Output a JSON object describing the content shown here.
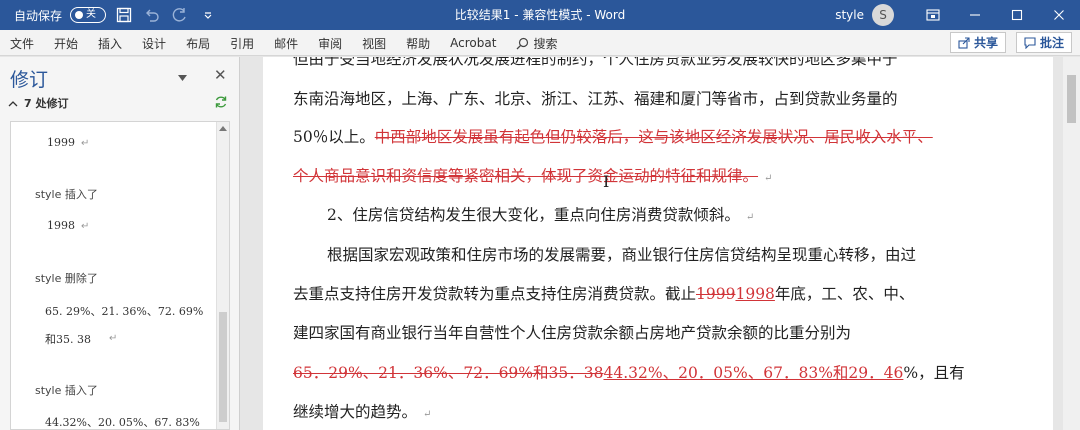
{
  "titlebar": {
    "autosave_label": "自动保存",
    "autosave_state": "关",
    "title": "比较结果1 - 兼容性模式 - Word",
    "user": "style",
    "avatar_letter": "S"
  },
  "menu": {
    "items": [
      "文件",
      "开始",
      "插入",
      "设计",
      "布局",
      "引用",
      "邮件",
      "审阅",
      "视图",
      "帮助",
      "Acrobat"
    ],
    "search": "搜索",
    "share": "共享",
    "comment": "批注"
  },
  "pane": {
    "title": "修订",
    "count": "7 处修订",
    "entries": [
      {
        "value": "1999"
      },
      {
        "head": "style 插入了",
        "value": "1998"
      },
      {
        "head": "style 删除了",
        "value": "65. 29%、21. 36%、72. 69%",
        "value2": "和35. 38"
      },
      {
        "head": "style 插入了",
        "value": "44.32%、20. 05%、67. 83%"
      }
    ]
  },
  "doc": {
    "line1": "但由于受当地经济发展状况发展进程的制约，个人住房贷款业务发展较快的地区多集中于",
    "line2": "东南沿海地区，上海、广东、北京、浙江、江苏、福建和厦门等省市，占到贷款业务量的",
    "line3_plain": "50％以上。",
    "line3_del": "中西部地区发展虽有起色但仍较落后，这与该地区经济发展状况、居民收入水平、",
    "line4_del": "个人商品意识和资信度等紧密相关，体现了资金运动的特征和规律。",
    "line5": "2、住房信贷结构发生很大变化，重点向住房消费贷款倾斜。",
    "line6": "根据国家宏观政策和住房市场的发展需要，商业银行住房信贷结构呈现重心转移，由过",
    "line7_a": "去重点支持住房开发贷款转为重点支持住房消费贷款。截止",
    "line7_del": "1999",
    "line7_ins": "1998",
    "line7_b": "年底，工、农、中、",
    "line8": "建四家国有商业银行当年自营性个人住房贷款余额占房地产贷款余额的比重分别为",
    "line9_del": "65．29%、21．36%、72．69%和35．38",
    "line9_ins": "44.32%、20．05%、67．83%和29．46",
    "line9_b": "%，且有",
    "line10": "继续增大的趋势。",
    "para_mark": "↵"
  }
}
